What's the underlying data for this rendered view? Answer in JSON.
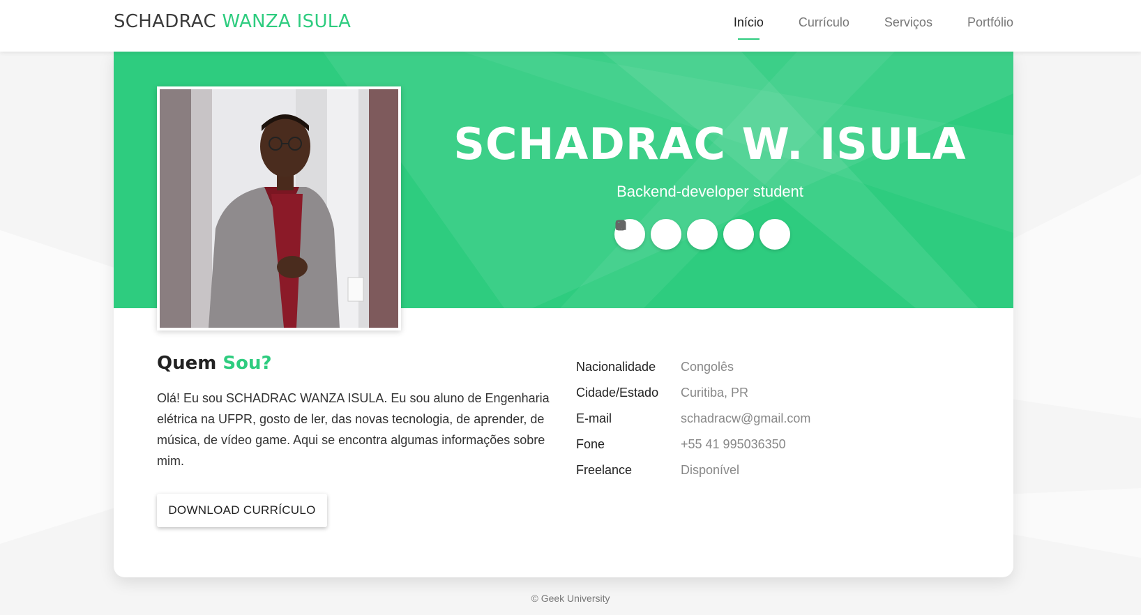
{
  "navbar": {
    "brand_first": "SCHADRAC",
    "brand_accent": "WANZA ISULA",
    "links": [
      {
        "label": "Início",
        "active": true
      },
      {
        "label": "Currículo",
        "active": false
      },
      {
        "label": "Serviços",
        "active": false
      },
      {
        "label": "Portfólio",
        "active": false
      }
    ]
  },
  "hero": {
    "title": "SCHADRAC W. ISULA",
    "subtitle": "Backend-developer student",
    "socials": [
      "twitter-icon",
      "facebook-icon",
      "instagram-icon",
      "linkedin-icon",
      "github-icon"
    ]
  },
  "about": {
    "title_first": "Quem",
    "title_accent": "Sou?",
    "text": "Olá! Eu sou SCHADRAC WANZA ISULA. Eu sou aluno de Engenharia elétrica na UFPR, gosto de ler, das novas tecnologia, de aprender, de música, de vídeo game. Aqui se encontra algumas informações sobre mim.",
    "download_label": "DOWNLOAD CURRÍCULO"
  },
  "info": [
    {
      "label": "Nacionalidade",
      "value": "Congolês"
    },
    {
      "label": "Cidade/Estado",
      "value": "Curitiba, PR"
    },
    {
      "label": "E-mail",
      "value": "schadracw@gmail.com"
    },
    {
      "label": "Fone",
      "value": "+55 41 995036350"
    },
    {
      "label": "Freelance",
      "value": "Disponível"
    }
  ],
  "footer": {
    "text": "© Geek University"
  },
  "colors": {
    "accent": "#2ecc7f",
    "background": "#f5f5f5"
  }
}
